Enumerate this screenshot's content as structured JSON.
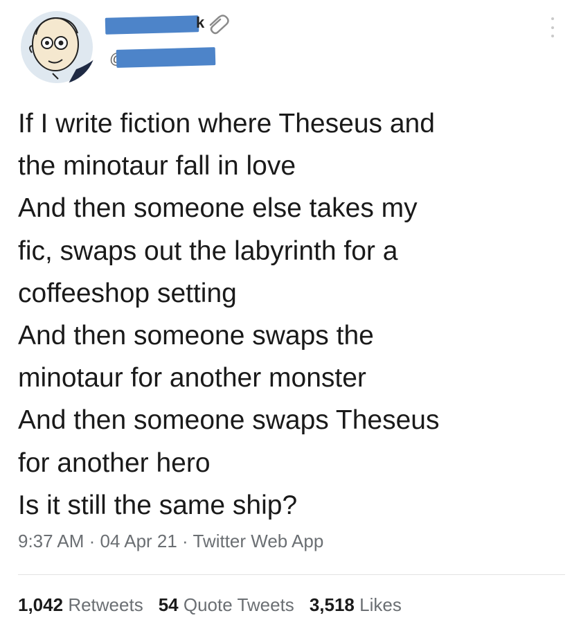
{
  "author": {
    "name_visible_tail": "k",
    "handle_at": "@"
  },
  "tweet": {
    "lines": [
      "If I write fiction where Theseus and",
      "the minotaur fall in love",
      "And then someone else takes my",
      "fic, swaps out the labyrinth for a",
      "coffeeshop setting",
      "And then someone swaps the",
      "minotaur for another monster",
      "And then someone swaps Theseus",
      "for another hero",
      "Is it still the same ship?"
    ],
    "time": "9:37 AM",
    "sep1": " · ",
    "date": "04 Apr 21",
    "sep2": " · ",
    "source": "Twitter Web App"
  },
  "stats": {
    "retweets_count": "1,042",
    "retweets_label": "Retweets",
    "quotes_count": "54",
    "quotes_label": "Quote Tweets",
    "likes_count": "3,518",
    "likes_label": "Likes"
  },
  "colors": {
    "redaction": "#4d84c9",
    "text": "#1a1a1a",
    "meta": "#6b6f73"
  },
  "icons": {
    "more": "more-vertical-icon",
    "clip": "paperclip-icon"
  }
}
